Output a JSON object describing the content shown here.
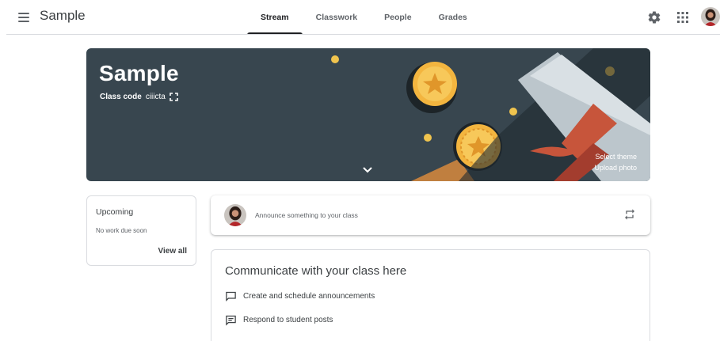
{
  "app": {
    "title": "Sample"
  },
  "tabs": [
    {
      "label": "Stream",
      "active": true
    },
    {
      "label": "Classwork",
      "active": false
    },
    {
      "label": "People",
      "active": false
    },
    {
      "label": "Grades",
      "active": false
    }
  ],
  "header_icons": [
    "menu-icon",
    "gear-icon",
    "apps-grid-icon",
    "avatar"
  ],
  "banner": {
    "title": "Sample",
    "class_code_label": "Class code",
    "class_code": "ciiicta",
    "select_theme": "Select theme",
    "upload_photo": "Upload photo",
    "background_color": "#38464f"
  },
  "upcoming": {
    "title": "Upcoming",
    "empty_text": "No work due soon",
    "view_all": "View all"
  },
  "announce": {
    "placeholder": "Announce something to your class"
  },
  "communicate": {
    "title": "Communicate with your class here",
    "items": [
      {
        "icon": "chat-bubble-icon",
        "label": "Create and schedule announcements"
      },
      {
        "icon": "comment-lines-icon",
        "label": "Respond to student posts"
      }
    ]
  },
  "colors": {
    "text": "#202124",
    "secondary": "#5f6368",
    "divider": "#dadce0"
  }
}
